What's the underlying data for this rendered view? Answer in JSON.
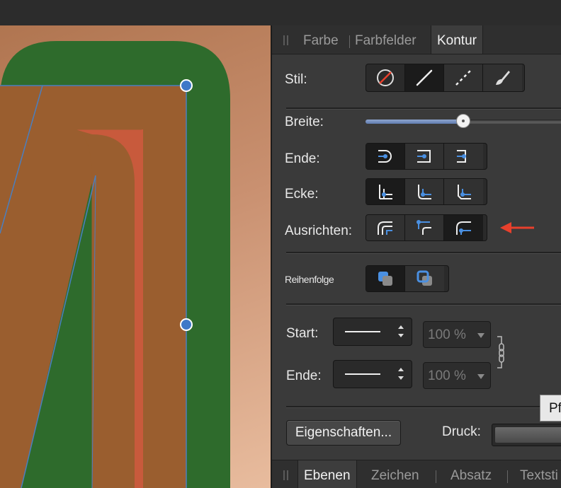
{
  "tabs": [
    {
      "label": "Farbe",
      "active": false
    },
    {
      "label": "Farbfelder",
      "active": false
    },
    {
      "label": "Kontur",
      "active": true
    }
  ],
  "stroke": {
    "stil_label": "Stil:",
    "stil_options": [
      "none-style-icon",
      "solid-line-icon",
      "dashed-line-icon",
      "brush-icon"
    ],
    "stil_selected": 1,
    "breite_label": "Breite:",
    "breite_level": 0.62,
    "ende_label": "Ende:",
    "ende_options": [
      "round-cap-icon",
      "square-cap-icon",
      "butt-cap-icon"
    ],
    "ende_selected": 0,
    "ecke_label": "Ecke:",
    "ecke_options": [
      "miter-join-icon",
      "round-join-icon",
      "bevel-join-icon"
    ],
    "ecke_selected": 0,
    "ausrichten_label": "Ausrichten:",
    "ausrichten_options": [
      "align-center-icon",
      "align-inside-icon",
      "align-outside-icon"
    ],
    "ausrichten_selected": 2,
    "reihenfolge_label": "Reihenfolge",
    "reihenfolge_options": [
      "stroke-behind-icon",
      "stroke-front-icon"
    ],
    "reihenfolge_selected": 0,
    "start_label": "Start:",
    "start_value": "100 %",
    "end_label": "Ende:",
    "end_value": "100 %",
    "properties_button": "Eigenschaften...",
    "druck_label": "Druck:",
    "tooltip_text": "Pf"
  },
  "bottom_tabs": [
    {
      "label": "Ebenen",
      "active": true
    },
    {
      "label": "Zeichen",
      "active": false
    },
    {
      "label": "Absatz",
      "active": false
    },
    {
      "label": "Textsti",
      "active": false
    }
  ],
  "colors": {
    "accent_blue": "#4a90e2",
    "arrow_red": "#e8402c",
    "canvas_green": "#2e6b2c",
    "canvas_brown": "#9a5e2f",
    "canvas_red": "#c85a3c"
  }
}
